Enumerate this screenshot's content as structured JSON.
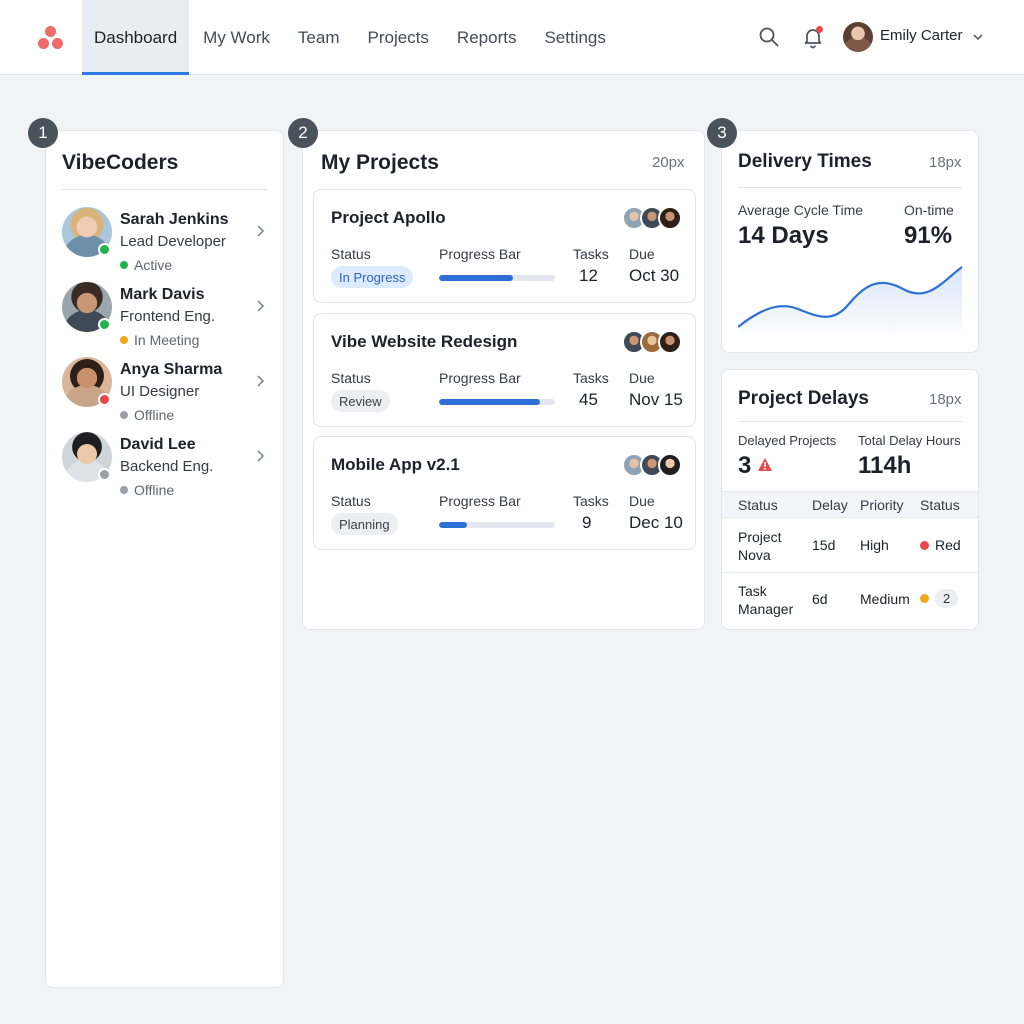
{
  "nav": {
    "logo_icon": "three-dots-logo-icon",
    "items": [
      {
        "label": "Dashboard",
        "active": true
      },
      {
        "label": "My Work"
      },
      {
        "label": "Team"
      },
      {
        "label": "Projects"
      },
      {
        "label": "Reports"
      },
      {
        "label": "Settings"
      }
    ],
    "user": {
      "name": "Emily Carter"
    }
  },
  "team_panel": {
    "badge": "1",
    "title": "VibeCoders",
    "members": [
      {
        "name": "Sarah Jenkins",
        "role": "Lead Developer",
        "status": "Active",
        "status_color": "#22b14c"
      },
      {
        "name": "Mark Davis",
        "role": "Frontend Eng.",
        "status": "In Meeting",
        "status_color": "#f0a81e"
      },
      {
        "name": "Anya Sharma",
        "role": "UI Designer",
        "status": "Offline",
        "status_color": "#9aa0a6",
        "presence_color": "#e5484d"
      },
      {
        "name": "David Lee",
        "role": "Backend Eng.",
        "status": "Offline",
        "status_color": "#9aa0a6"
      }
    ]
  },
  "projects_panel": {
    "badge": "2",
    "title": "My Projects",
    "meta": "20px",
    "labels": {
      "status": "Status",
      "progress": "Progress Bar",
      "tasks": "Tasks",
      "due": "Due"
    },
    "projects": [
      {
        "name": "Project Apollo",
        "status": "In Progress",
        "status_style": "blue",
        "progress": 0.64,
        "tasks": "12",
        "due": "Oct 30"
      },
      {
        "name": "Vibe Website Redesign",
        "status": "Review",
        "status_style": "gray",
        "progress": 0.87,
        "tasks": "45",
        "due": "Nov 15"
      },
      {
        "name": "Mobile App v2.1",
        "status": "Planning",
        "status_style": "gray",
        "progress": 0.24,
        "tasks": "9",
        "due": "Dec 10"
      }
    ]
  },
  "delivery_panel": {
    "badge": "3",
    "title": "Delivery Times",
    "meta": "18px",
    "cycle_label": "Average Cycle Time",
    "cycle_value": "14 Days",
    "ontime_label": "On-time",
    "ontime_value": "91%"
  },
  "delays_panel": {
    "title": "Project Delays",
    "meta": "18px",
    "delayed_label": "Delayed Projects",
    "delayed_value": "3",
    "hours_label": "Total Delay Hours",
    "hours_value": "114h",
    "columns": [
      "Status",
      "Delay",
      "Priority",
      "Status"
    ],
    "rows": [
      {
        "name_line1": "Project",
        "name_line2": "Nova",
        "delay": "15d",
        "priority": "Priority_high",
        "priority_label": "High",
        "status": "Red",
        "status_color": "#e5484d"
      },
      {
        "name_line1": "Task",
        "name_line2": "Manager",
        "delay": "6d",
        "priority_label": "Medium",
        "status": "2",
        "status_color": "#f0a81e"
      }
    ]
  },
  "colors": {
    "accent": "#2f7ae5",
    "brand": "#f06a6a",
    "progress": "#2d6fd6"
  }
}
